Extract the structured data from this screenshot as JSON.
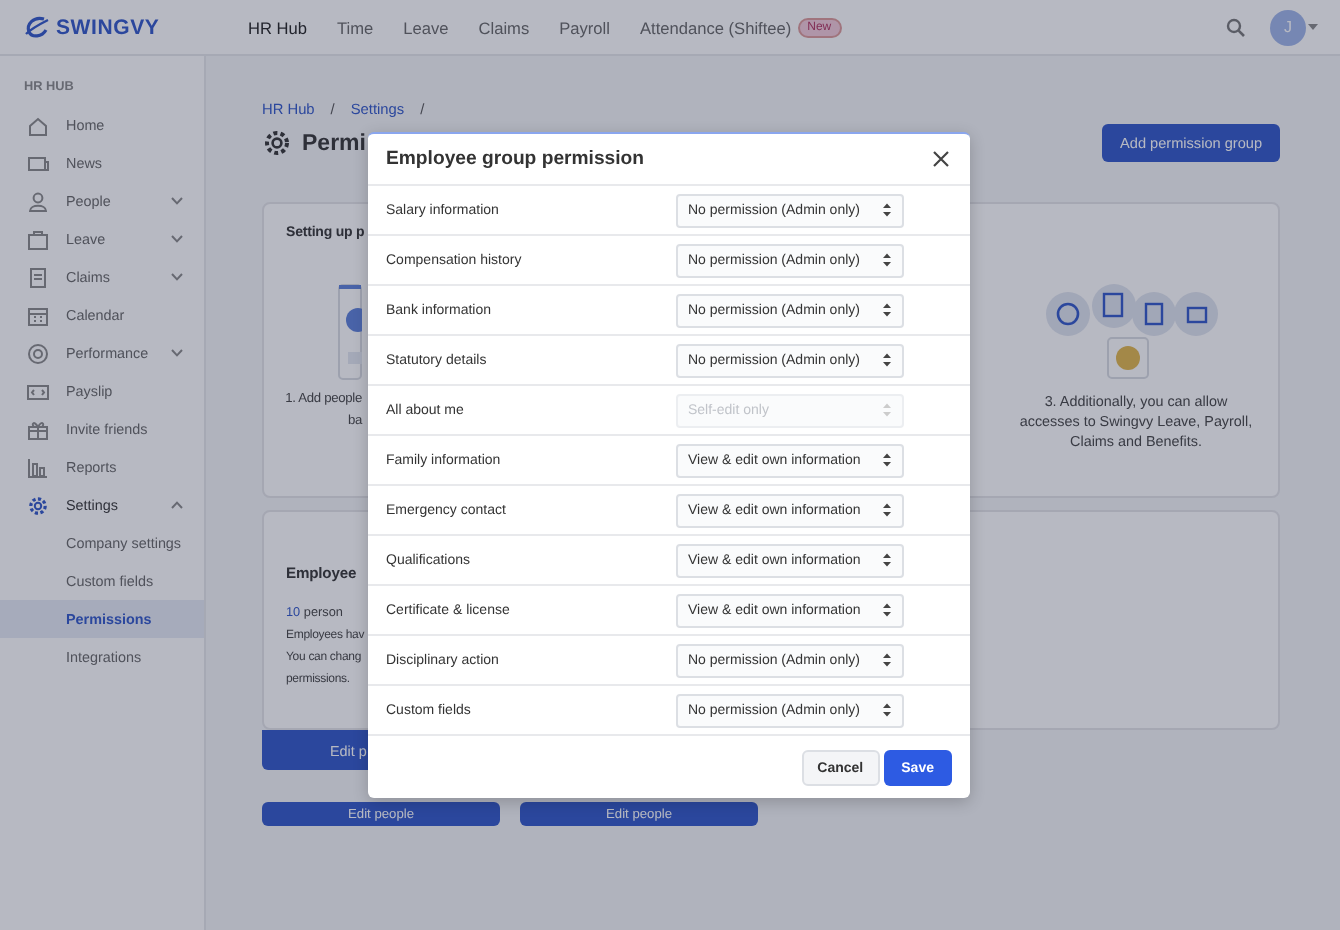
{
  "header": {
    "logo": "SWINGVY",
    "avatar": "J",
    "nav": [
      {
        "label": "HR Hub",
        "selected": true
      },
      {
        "label": "Time",
        "selected": false
      },
      {
        "label": "Leave",
        "selected": false
      },
      {
        "label": "Claims",
        "selected": false
      },
      {
        "label": "Payroll",
        "selected": false
      },
      {
        "label": "Attendance (Shiftee)",
        "selected": false,
        "badge": "New"
      }
    ]
  },
  "sidebar": {
    "section": "HR HUB",
    "items": [
      {
        "label": "Home",
        "selected": false
      },
      {
        "label": "News",
        "selected": false
      },
      {
        "label": "People",
        "selected": false,
        "expanded": false
      },
      {
        "label": "Leave",
        "selected": false,
        "expanded": false
      },
      {
        "label": "Claims",
        "selected": false,
        "expanded": false
      },
      {
        "label": "Calendar",
        "selected": false
      },
      {
        "label": "Performance",
        "selected": false,
        "expanded": false
      },
      {
        "label": "Payslip",
        "selected": false
      },
      {
        "label": "Invite friends",
        "selected": false
      },
      {
        "label": "Reports",
        "selected": false
      },
      {
        "label": "Settings",
        "selected": true,
        "expanded": true,
        "children": [
          {
            "label": "Company settings",
            "selected": false
          },
          {
            "label": "Custom fields",
            "selected": false
          },
          {
            "label": "Permissions",
            "selected": true
          },
          {
            "label": "Integrations",
            "selected": false
          }
        ]
      }
    ]
  },
  "main": {
    "breadcrumb": {
      "items": [
        "HR Hub",
        "Settings"
      ],
      "separator": "/"
    },
    "title": "Permi",
    "add_button": "Add permission group",
    "setup_card": {
      "title": "Setting up p",
      "step_1": [
        "1. Add people",
        "ba"
      ],
      "step_3": "3. Additionally, you can allow accesses to Swingvy Leave, Payroll, Claims and Benefits."
    },
    "employee_card": {
      "title": "Employee",
      "count": "10",
      "count_label": "person",
      "lines": [
        "Employees hav",
        "You can chang",
        "permissions."
      ],
      "buttons": [
        "Edit p",
        "Edit people",
        "Edit people"
      ]
    }
  },
  "modal": {
    "title": "Employee group permission",
    "rows": [
      {
        "label": "Salary information",
        "value": "No permission (Admin only)",
        "disabled": false
      },
      {
        "label": "Compensation history",
        "value": "No permission (Admin only)",
        "disabled": false
      },
      {
        "label": "Bank information",
        "value": "No permission (Admin only)",
        "disabled": false
      },
      {
        "label": "Statutory details",
        "value": "No permission (Admin only)",
        "disabled": false
      },
      {
        "label": "All about me",
        "value": "Self-edit only",
        "disabled": true
      },
      {
        "label": "Family information",
        "value": "View & edit own information",
        "disabled": false
      },
      {
        "label": "Emergency contact",
        "value": "View & edit own information",
        "disabled": false
      },
      {
        "label": "Qualifications",
        "value": "View & edit own information",
        "disabled": false
      },
      {
        "label": "Certificate & license",
        "value": "View & edit own information",
        "disabled": false
      },
      {
        "label": "Disciplinary action",
        "value": "No permission (Admin only)",
        "disabled": false
      },
      {
        "label": "Custom fields",
        "value": "No permission (Admin only)",
        "disabled": false
      }
    ],
    "cancel": "Cancel",
    "save": "Save"
  }
}
